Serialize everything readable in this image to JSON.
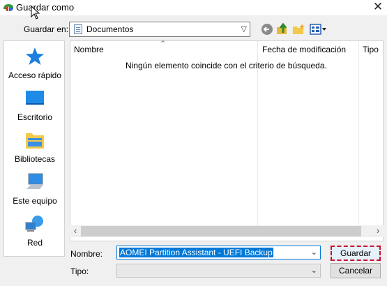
{
  "window": {
    "title": "Guardar como"
  },
  "toolbar": {
    "look_in_label": "Guardar en:",
    "look_in_value": "Documentos"
  },
  "places": [
    {
      "label": "Acceso rápido",
      "icon": "star-icon"
    },
    {
      "label": "Escritorio",
      "icon": "desktop-icon"
    },
    {
      "label": "Bibliotecas",
      "icon": "libraries-icon"
    },
    {
      "label": "Este equipo",
      "icon": "computer-icon"
    },
    {
      "label": "Red",
      "icon": "network-icon"
    }
  ],
  "file_list": {
    "columns": [
      "Nombre",
      "Fecha de modificación",
      "Tipo"
    ],
    "empty_message": "Ningún elemento coincide con el criterio de búsqueda."
  },
  "form": {
    "name_label": "Nombre:",
    "name_value": "AOMEI Partition Assistant - UEFI Backup",
    "type_label": "Tipo:",
    "type_value": ""
  },
  "buttons": {
    "save": "Guardar",
    "cancel": "Cancelar"
  },
  "colors": {
    "accent": "#0078d7",
    "highlight_border": "#c8102e"
  }
}
